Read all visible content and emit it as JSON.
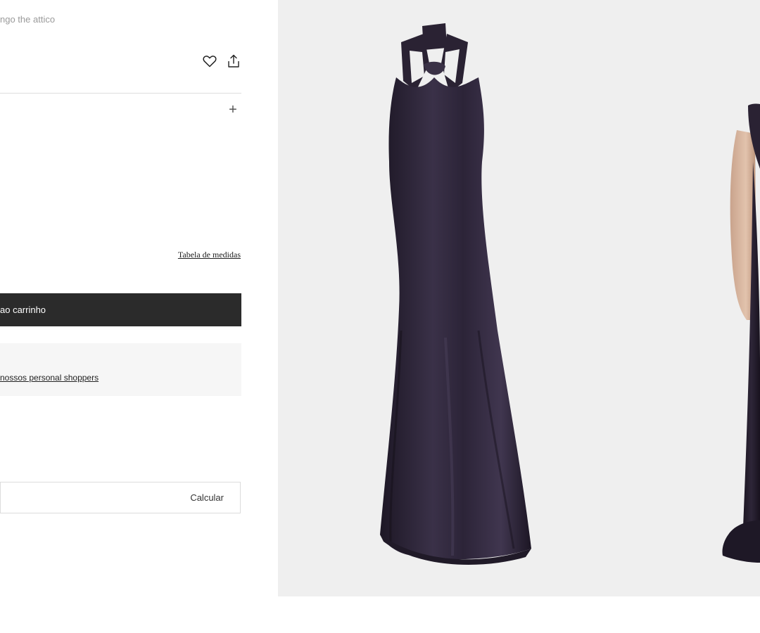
{
  "breadcrumb": {
    "text": "ngo the attico"
  },
  "actions": {
    "favorite_icon": "heart-icon",
    "share_icon": "share-icon"
  },
  "details": {
    "toggle_symbol": "+"
  },
  "size": {
    "guide_label": "Tabela de medidas"
  },
  "cart": {
    "button_label": "ao carrinho"
  },
  "personal_shopper": {
    "link_label": "nossos personal shoppers"
  },
  "shipping": {
    "input_value": "",
    "calculate_label": "Calcular"
  },
  "gallery": {
    "background_color": "#efefef",
    "dress_color": "#2e2738"
  }
}
